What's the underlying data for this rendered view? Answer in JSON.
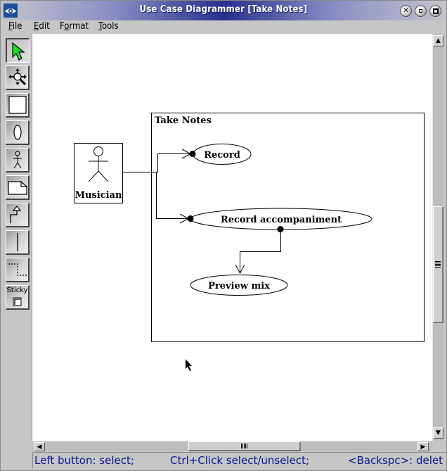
{
  "window": {
    "title": "Use Case Diagrammer [Take Notes]",
    "controls": {
      "close": "close",
      "minimize": "minimize",
      "maximize": "maximize"
    }
  },
  "menubar": {
    "items": [
      {
        "label": "File",
        "mnemonic": "F"
      },
      {
        "label": "Edit",
        "mnemonic": "E"
      },
      {
        "label": "Format",
        "mnemonic": "o"
      },
      {
        "label": "Tools",
        "mnemonic": "T"
      }
    ]
  },
  "toolbar": {
    "tools": [
      {
        "name": "select-tool",
        "icon": "green-arrow-icon",
        "active": true
      },
      {
        "name": "move-resize-tool",
        "icon": "move-zoom-icon",
        "active": false
      },
      {
        "name": "system-boundary-tool",
        "icon": "rectangle-icon",
        "active": false
      },
      {
        "name": "use-case-tool",
        "icon": "ellipse-icon",
        "active": false
      },
      {
        "name": "actor-tool",
        "icon": "stick-figure-icon",
        "active": false
      },
      {
        "name": "note-tool",
        "icon": "note-icon",
        "active": false
      },
      {
        "name": "generalization-tool",
        "icon": "hollow-arrow-connector-icon",
        "active": false
      },
      {
        "name": "association-tool",
        "icon": "line-icon",
        "active": false
      },
      {
        "name": "dependency-tool",
        "icon": "dashed-connector-icon",
        "active": false
      },
      {
        "name": "sticky-tool",
        "icon": "checkbox-icon",
        "active": false,
        "label": "Sticky"
      }
    ]
  },
  "diagram": {
    "system_boundary": {
      "label": "Take Notes"
    },
    "actor": {
      "label": "Musician"
    },
    "use_cases": [
      {
        "id": "record",
        "label": "Record"
      },
      {
        "id": "record-accompaniment",
        "label": "Record accompaniment"
      },
      {
        "id": "preview-mix",
        "label": "Preview mix"
      }
    ],
    "links": [
      {
        "from": "Musician",
        "to": "Record",
        "type": "association"
      },
      {
        "from": "Musician",
        "to": "Record accompaniment",
        "type": "association"
      },
      {
        "from": "Record accompaniment",
        "to": "Preview mix",
        "type": "association"
      }
    ]
  },
  "scrollbars": {
    "vertical": {
      "up": "▲",
      "down": "▼"
    },
    "horizontal": {
      "left": "◀",
      "right": "▶"
    }
  },
  "statusbar": {
    "segments": [
      "Left button: select;",
      "Ctrl+Click select/unselect;",
      "<Backspc>: delet"
    ]
  }
}
